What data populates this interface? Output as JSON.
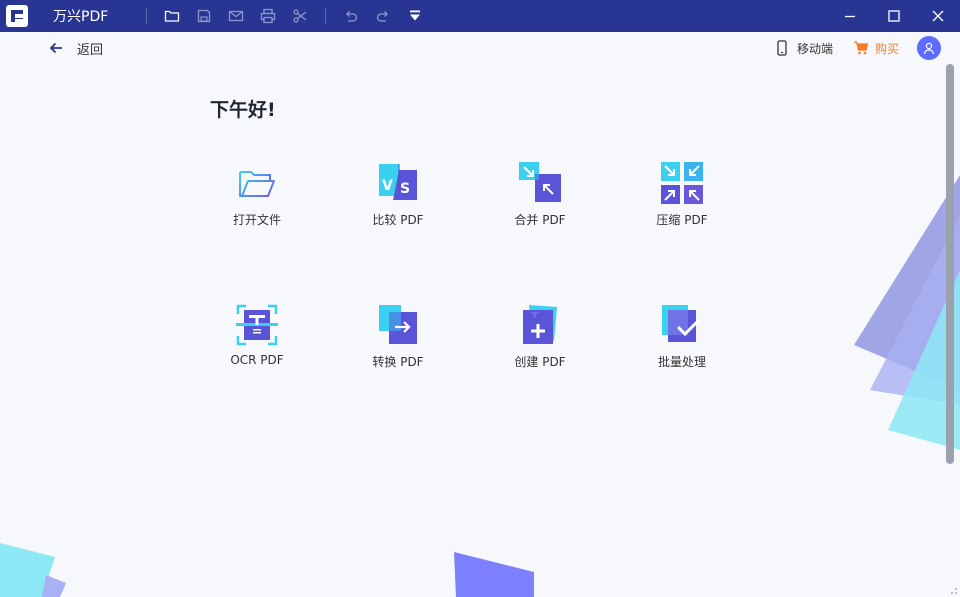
{
  "titlebar": {
    "app_title": "万兴PDF",
    "icons": [
      "folder-icon",
      "save-icon",
      "mail-icon",
      "print-icon",
      "scissors-icon",
      "undo-icon",
      "redo-icon",
      "dropdown-icon"
    ]
  },
  "window_controls": [
    "minimize-icon",
    "maximize-icon",
    "close-icon"
  ],
  "header": {
    "back_label": "返回",
    "mobile_label": "移动端",
    "buy_label": "购买"
  },
  "greeting": "下午好!",
  "tools": [
    {
      "label": "打开文件",
      "icon": "open-file-icon"
    },
    {
      "label": "比较 PDF",
      "icon": "compare-pdf-icon"
    },
    {
      "label": "合并 PDF",
      "icon": "merge-pdf-icon"
    },
    {
      "label": "压缩 PDF",
      "icon": "compress-pdf-icon"
    },
    {
      "label": "OCR PDF",
      "icon": "ocr-pdf-icon"
    },
    {
      "label": "转换 PDF",
      "icon": "convert-pdf-icon"
    },
    {
      "label": "创建 PDF",
      "icon": "create-pdf-icon"
    },
    {
      "label": "批量处理",
      "icon": "batch-process-icon"
    }
  ],
  "colors": {
    "titlebar": "#283593",
    "accent": "#5b6cff",
    "buy": "#f57c2a",
    "cyan": "#3ad1f0"
  }
}
